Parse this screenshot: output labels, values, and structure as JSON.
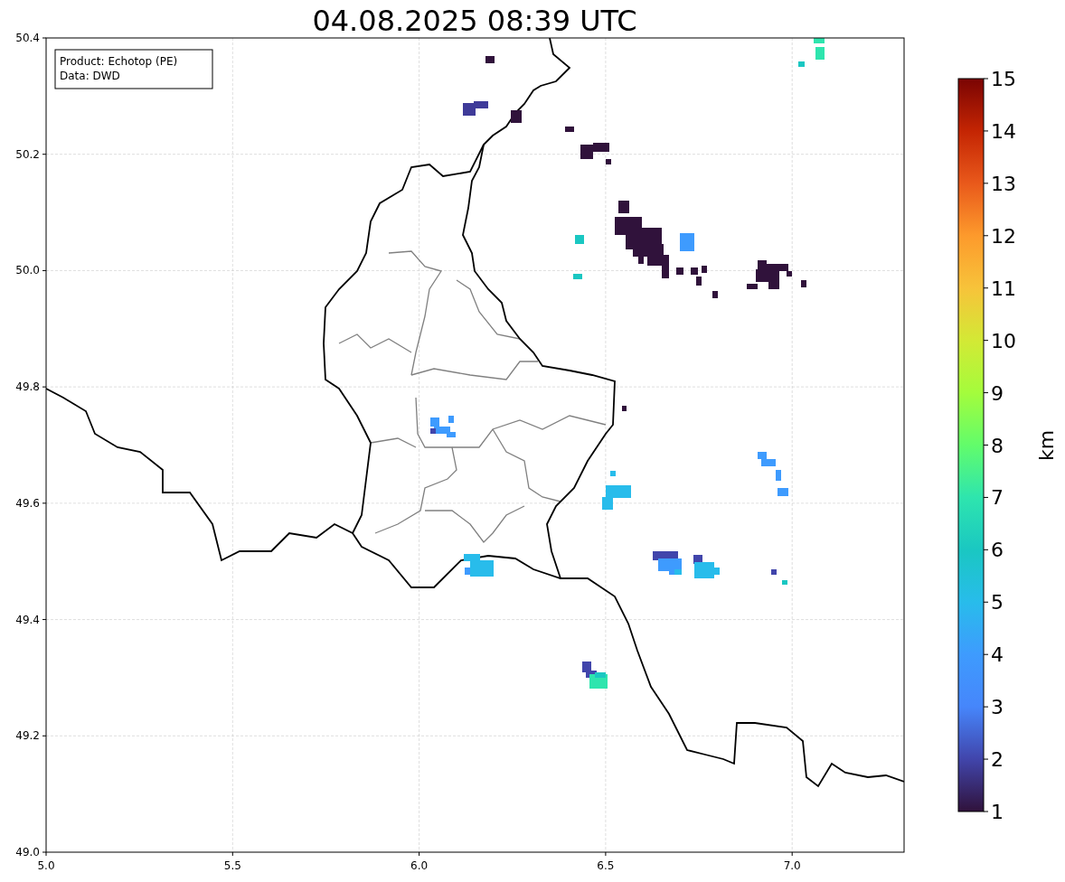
{
  "title": "04.08.2025 08:39 UTC",
  "info_box": {
    "lines": [
      "Product: Echotop (PE)",
      "Data: DWD"
    ]
  },
  "x_axis": {
    "ticks": [
      "5.0",
      "5.5",
      "6.0",
      "6.5",
      "7.0"
    ]
  },
  "y_axis": {
    "ticks": [
      "50.4",
      "50.2",
      "50.0",
      "49.8",
      "49.6",
      "49.4",
      "49.2",
      "49.0"
    ]
  },
  "colorbar": {
    "ticks": [
      "15",
      "14",
      "13",
      "12",
      "11",
      "10",
      "9",
      "8",
      "7",
      "6",
      "5",
      "4",
      "3",
      "2",
      "1"
    ],
    "label": "km"
  }
}
